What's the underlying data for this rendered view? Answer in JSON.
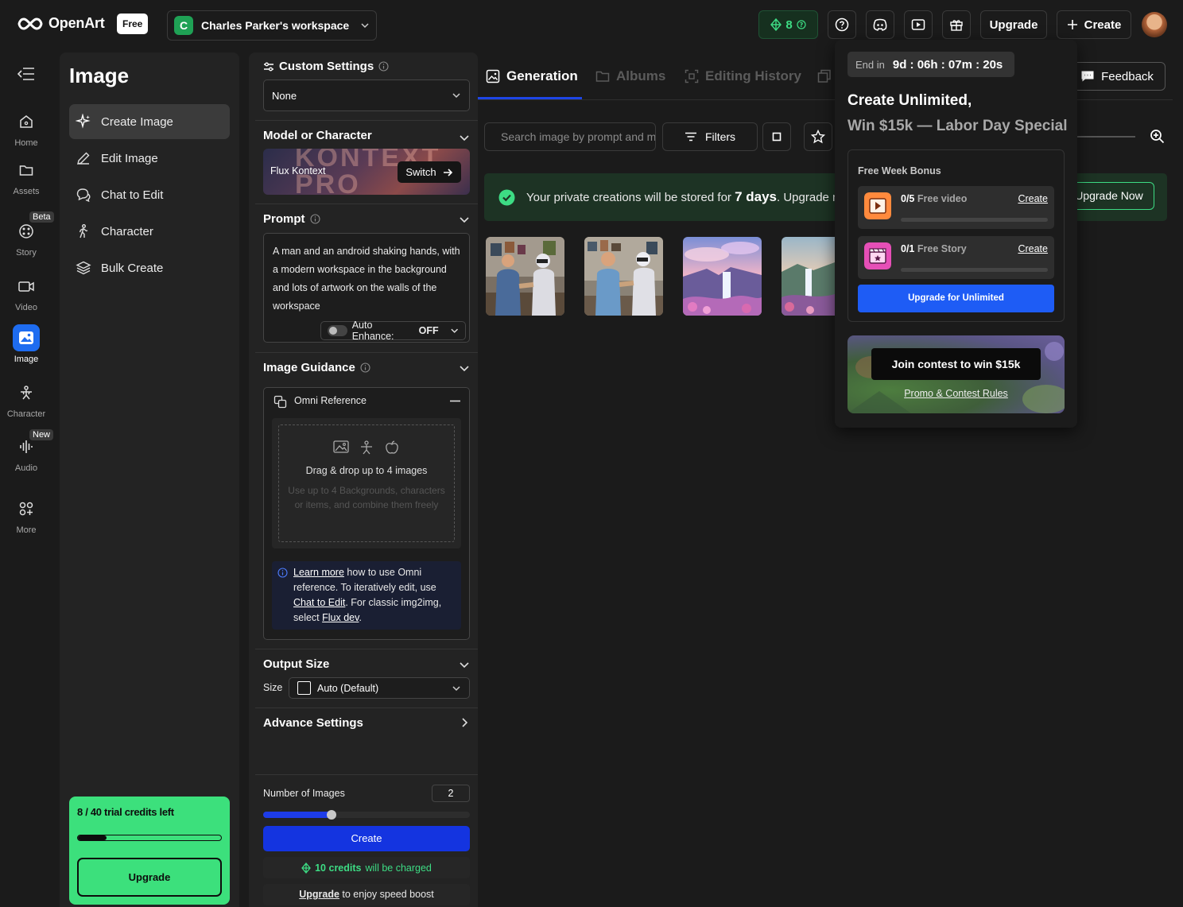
{
  "app": {
    "brand": "OpenArt",
    "plan_badge": "Free"
  },
  "workspace": {
    "initial": "C",
    "name": "Charles Parker's workspace"
  },
  "topbar": {
    "credits": "8",
    "upgrade_label": "Upgrade",
    "create_label": "Create"
  },
  "rail": {
    "items": [
      {
        "label": "Home",
        "icon": "home-icon"
      },
      {
        "label": "Assets",
        "icon": "folder-icon"
      },
      {
        "label": "Story",
        "icon": "film-reel-icon",
        "badge": "Beta"
      },
      {
        "label": "Video",
        "icon": "video-camera-icon"
      },
      {
        "label": "Image",
        "icon": "image-icon",
        "active": true
      },
      {
        "label": "Character",
        "icon": "character-icon"
      },
      {
        "label": "Audio",
        "icon": "audio-wave-icon",
        "badge": "New"
      },
      {
        "label": "More",
        "icon": "grid-icon"
      }
    ]
  },
  "sidepanel": {
    "title": "Image",
    "items": [
      {
        "label": "Create Image",
        "icon": "sparkle-icon",
        "active": true
      },
      {
        "label": "Edit Image",
        "icon": "pencil-icon"
      },
      {
        "label": "Chat to Edit",
        "icon": "chat-icon"
      },
      {
        "label": "Character",
        "icon": "walking-person-icon"
      },
      {
        "label": "Bulk Create",
        "icon": "layers-icon"
      }
    ],
    "trial": {
      "text": "8 / 40 trial credits left",
      "used_fraction": 0.2,
      "button": "Upgrade"
    }
  },
  "settings": {
    "custom_settings": {
      "title": "Custom Settings",
      "value": "None"
    },
    "model": {
      "title": "Model or Character",
      "name": "Flux Kontext",
      "bg_text": "KONTEXT PRO",
      "switch_label": "Switch"
    },
    "prompt": {
      "title": "Prompt",
      "text": "A man and an android shaking hands, with a modern workspace in the background and lots of artwork on the walls of the workspace",
      "auto_enhance_label": "Auto Enhance:",
      "auto_enhance_value": "OFF"
    },
    "guidance": {
      "title": "Image Guidance",
      "omni_title": "Omni Reference",
      "drop_title": "Drag & drop up to 4 images",
      "drop_sub": "Use up to 4 Backgrounds, characters or items, and combine them freely",
      "info_link1": "Learn more",
      "info_text1": " how to use Omni reference. To iteratively edit, use ",
      "info_link2": "Chat to Edit",
      "info_text2": ". For classic img2img, select ",
      "info_link3": "Flux dev",
      "info_text3": "."
    },
    "output": {
      "title": "Output Size",
      "size_label": "Size",
      "size_value": "Auto (Default)"
    },
    "advance": {
      "title": "Advance Settings"
    },
    "num_images": {
      "label": "Number of Images",
      "value": "2",
      "slider_fraction": 0.33
    },
    "create_label": "Create",
    "charge_note": {
      "amount": "10 credits",
      "text": "will be charged"
    },
    "speed_note": {
      "link": "Upgrade",
      "text": " to enjoy speed boost"
    }
  },
  "main": {
    "tabs": [
      {
        "label": "Generation",
        "icon": "image-gallery-icon",
        "active": true
      },
      {
        "label": "Albums",
        "icon": "folder-icon"
      },
      {
        "label": "Editing History",
        "icon": "history-frame-icon"
      }
    ],
    "search_placeholder": "Search image by prompt and more",
    "filters_label": "Filters",
    "feedback_label": "Feedback",
    "banner": {
      "prefix": "Your private creations will be stored for ",
      "days": "7 days",
      "suffix": ". Upgrade now to keep them forever",
      "button": "Upgrade Now"
    },
    "thumbnails": [
      "handshake-1",
      "handshake-2",
      "waterfall-1",
      "waterfall-2"
    ]
  },
  "popup": {
    "timer_label": "End in",
    "timer_value": "9d : 06h : 07m : 20s",
    "headline": "Create Unlimited,",
    "subheadline": "Win $15k — Labor Day Special",
    "bonus_title": "Free Week Bonus",
    "rows": [
      {
        "count": "0/5",
        "label": "Free video",
        "action": "Create",
        "progress": 0
      },
      {
        "count": "0/1",
        "label": "Free Story",
        "action": "Create",
        "progress": 0
      }
    ],
    "upgrade_button": "Upgrade for Unlimited",
    "contest_button": "Join contest to win $15k",
    "contest_link": "Promo & Contest Rules"
  },
  "colors": {
    "accent_blue": "#1e46e6",
    "green": "#3ce07c",
    "bg": "#1b1b1b",
    "panel": "#232323"
  }
}
